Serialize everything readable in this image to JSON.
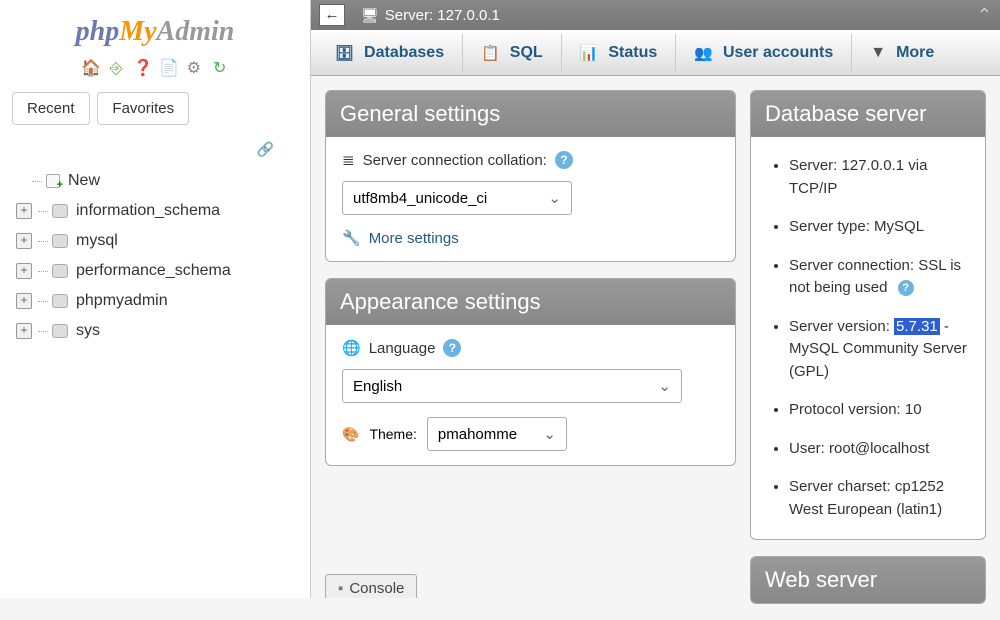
{
  "logo": {
    "part1": "php",
    "part2": "My",
    "part3": "Admin"
  },
  "sidebar": {
    "recent_label": "Recent",
    "favorites_label": "Favorites",
    "new_label": "New",
    "databases": [
      "information_schema",
      "mysql",
      "performance_schema",
      "phpmyadmin",
      "sys"
    ]
  },
  "server_bar": {
    "back": "←",
    "label": "Server: 127.0.0.1"
  },
  "tabs": {
    "databases": "Databases",
    "sql": "SQL",
    "status": "Status",
    "user_accounts": "User accounts",
    "more": "More"
  },
  "general": {
    "title": "General settings",
    "collation_label": "Server connection collation:",
    "collation_value": "utf8mb4_unicode_ci",
    "more_settings": "More settings"
  },
  "appearance": {
    "title": "Appearance settings",
    "language_label": "Language",
    "language_value": "English",
    "theme_label": "Theme:",
    "theme_value": "pmahomme"
  },
  "db_server": {
    "title": "Database server",
    "items": {
      "server": "Server: 127.0.0.1 via TCP/IP",
      "type": "Server type: MySQL",
      "connection": "Server connection: SSL is not being used",
      "version_prefix": "Server version: ",
      "version_hl": "5.7.31",
      "version_suffix": " - MySQL Community Server (GPL)",
      "protocol": "Protocol version: 10",
      "user": "User: root@localhost",
      "charset": "Server charset: cp1252 West European (latin1)"
    }
  },
  "web_server": {
    "title": "Web server"
  },
  "console": {
    "label": "Console"
  }
}
